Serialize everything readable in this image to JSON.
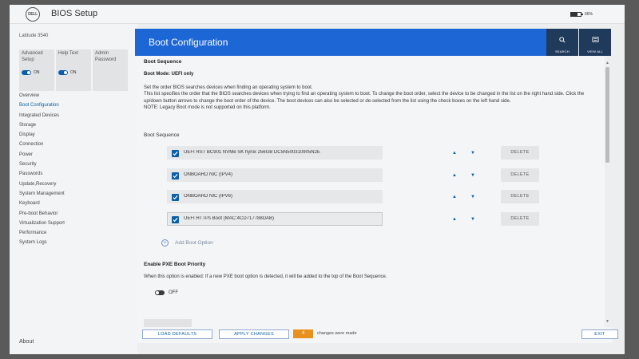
{
  "topbar": {
    "logo_text": "DELL",
    "title": "BIOS Setup",
    "battery": "66%",
    "battery_level": 0.66
  },
  "sidebar": {
    "model": "Latitude 3540",
    "tiles": [
      {
        "label": "Advanced Setup",
        "state": "ON"
      },
      {
        "label": "Help Text",
        "state": "ON"
      },
      {
        "label": "Admin Password",
        "state": ""
      }
    ],
    "nav": [
      {
        "label": "Overview",
        "active": false
      },
      {
        "label": "Boot Configuration",
        "active": true
      },
      {
        "label": "Integrated Devices",
        "active": false
      },
      {
        "label": "Storage",
        "active": false
      },
      {
        "label": "Display",
        "active": false
      },
      {
        "label": "Connection",
        "active": false
      },
      {
        "label": "Power",
        "active": false
      },
      {
        "label": "Security",
        "active": false
      },
      {
        "label": "Passwords",
        "active": false
      },
      {
        "label": "Update,Recovery",
        "active": false
      },
      {
        "label": "System Management",
        "active": false
      },
      {
        "label": "Keyboard",
        "active": false
      },
      {
        "label": "Pre-boot Behavior",
        "active": false
      },
      {
        "label": "Virtualization Support",
        "active": false
      },
      {
        "label": "Performance",
        "active": false
      },
      {
        "label": "System Logs",
        "active": false
      }
    ],
    "about": "About"
  },
  "header": {
    "title": "Boot Configuration",
    "search_label": "SEARCH",
    "view_all_label": "VIEW ALL"
  },
  "content": {
    "section_title": "Boot Sequence",
    "boot_mode": "Boot Mode: UEFI only",
    "description": [
      "Set the order BIOS searches devices when finding an operating system to boot.",
      "This list specifies the order that the BIOS searches devices when trying to find an operating system to boot.  To change the boot order, select the device to be changed in the list on the right hand side.  Click the up/down button arrows to change the boot order of the device.  The boot devices can also be selected or de-selected from the list using the check boxes on the left hand side.",
      "NOTE: Legacy Boot mode is not supported on this platform."
    ],
    "boot_sequence_label": "Boot Sequence",
    "boot_items": [
      {
        "name": "UEFI RST BC901 NVMe SK hynix 256GB DC5N500310905N2E",
        "checked": true
      },
      {
        "name": "ONBOARD NIC (IPV4)",
        "checked": true
      },
      {
        "name": "ONBOARD NIC (IPV6)",
        "checked": true
      },
      {
        "name": "UEFI HTTPs Boot (MAC:4CD717788DAB)",
        "checked": true
      }
    ],
    "delete_label": "DELETE",
    "add_boot_option": "Add Boot Option",
    "pxe_title": "Enable PXE Boot Priority",
    "pxe_description": "When this option is enabled: If a new PXE boot option is detected, it will be added to the top of the Boot Sequence.",
    "pxe_state": "OFF"
  },
  "bottom": {
    "load_defaults": "LOAD DEFAULTS",
    "apply_changes": "APPLY CHANGES",
    "changes_count": "4",
    "changes_label": "changes were made",
    "exit": "EXIT"
  },
  "colors": {
    "accent": "#1d66d6",
    "header_dark": "#203a5c",
    "badge": "#e8911f",
    "checkbox": "#0b5ea8"
  }
}
